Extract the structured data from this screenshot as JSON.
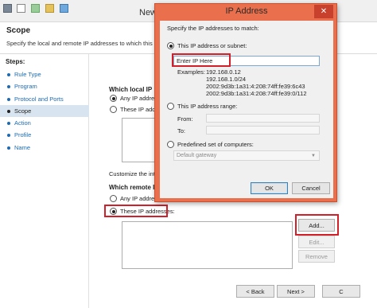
{
  "wizard": {
    "title": "New",
    "heading": "Scope",
    "description": "Specify the local and remote IP addresses to which this rule a",
    "steps_label": "Steps:",
    "steps": [
      {
        "label": "Rule Type",
        "active": false
      },
      {
        "label": "Program",
        "active": false
      },
      {
        "label": "Protocol and Ports",
        "active": false
      },
      {
        "label": "Scope",
        "active": true
      },
      {
        "label": "Action",
        "active": false
      },
      {
        "label": "Profile",
        "active": false
      },
      {
        "label": "Name",
        "active": false
      }
    ],
    "local_section": {
      "label": "Which local IP",
      "any_option": "Any IP addres",
      "these_option": "These IP addres"
    },
    "customize_text": "Customize the inte",
    "remote_section": {
      "label": "Which remote I",
      "any_option": "Any IP addres",
      "these_option": "These IP addresses:"
    },
    "buttons": {
      "add": "Add...",
      "edit": "Edit...",
      "remove": "Remove",
      "back": "< Back",
      "next": "Next >",
      "cancel": "C"
    }
  },
  "dialog": {
    "title": "IP Address",
    "close_glyph": "✕",
    "prompt": "Specify the IP addresses to match:",
    "option_subnet": "This IP address or subnet:",
    "ip_value": "Enter IP Here",
    "examples_label": "Examples:",
    "examples": [
      "192.168.0.12",
      "192.168.1.0/24",
      "2002:9d3b:1a31:4:208:74ff:fe39:6c43",
      "2002:9d3b:1a31:4:208:74ff:fe39:0/112"
    ],
    "option_range": "This IP address range:",
    "from_label": "From:",
    "to_label": "To:",
    "option_predefined": "Predefined set of computers:",
    "predefined_value": "Default gateway",
    "ok_label": "OK",
    "cancel_label": "Cancel"
  },
  "colors": {
    "dialog_frame": "#ea6f4d",
    "highlight": "#d21f2a",
    "link": "#1a6bb5",
    "selected_step": "#d9e4f1"
  }
}
